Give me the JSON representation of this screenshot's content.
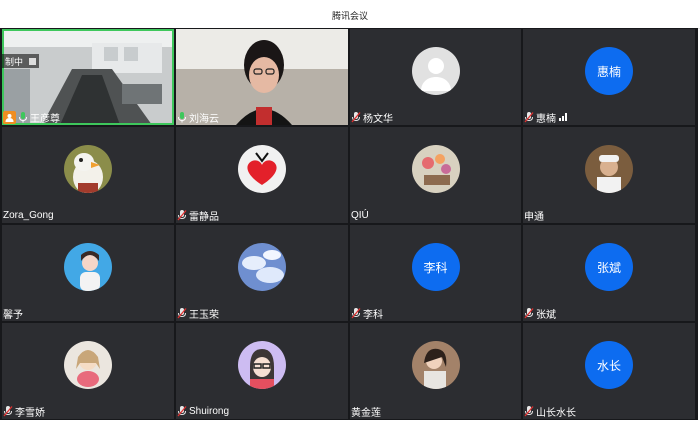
{
  "window": {
    "title": "腾讯会议"
  },
  "recording": {
    "label": "制中"
  },
  "participants": [
    {
      "name": "王彦尊",
      "kind": "video-room",
      "mic": "on",
      "host": true
    },
    {
      "name": "刘海云",
      "kind": "video-person",
      "mic": "on"
    },
    {
      "name": "杨文华",
      "kind": "default-avatar",
      "mic": "muted"
    },
    {
      "name": "惠楠",
      "kind": "initials",
      "initials": "惠楠",
      "mic": "muted",
      "signal": true
    },
    {
      "name": "Zora_Gong",
      "kind": "photo-penguin",
      "mic": "none"
    },
    {
      "name": "雷静品",
      "kind": "photo-heart",
      "mic": "muted"
    },
    {
      "name": "QIÚ",
      "kind": "photo-flowers",
      "mic": "none"
    },
    {
      "name": "申通",
      "kind": "photo-person-hat",
      "mic": "none"
    },
    {
      "name": "馨予",
      "kind": "photo-girl",
      "mic": "none"
    },
    {
      "name": "王玉荣",
      "kind": "photo-sky",
      "mic": "muted"
    },
    {
      "name": "李科",
      "kind": "initials",
      "initials": "李科",
      "mic": "muted"
    },
    {
      "name": "张斌",
      "kind": "initials",
      "initials": "张斌",
      "mic": "muted"
    },
    {
      "name": "李雪娇",
      "kind": "photo-doll",
      "mic": "muted"
    },
    {
      "name": "Shuirong",
      "kind": "photo-cartoon",
      "mic": "muted"
    },
    {
      "name": "黄金莲",
      "kind": "photo-woman",
      "mic": "none"
    },
    {
      "name": "山长水长",
      "kind": "initials",
      "initials": "水长",
      "mic": "muted"
    }
  ],
  "colors": {
    "initials_bg": "#0d6cf0",
    "active_border": "#3ec75c",
    "tile_bg": "#2c2d31"
  }
}
